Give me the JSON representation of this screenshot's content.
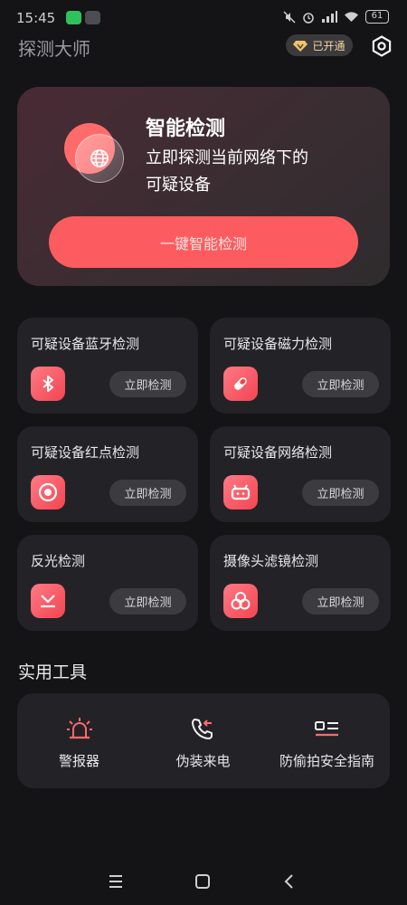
{
  "status": {
    "time": "15:45",
    "battery": "61"
  },
  "app": {
    "title": "探测大师"
  },
  "vip": {
    "label": "已开通"
  },
  "hero": {
    "title": "智能检测",
    "desc_line1": "立即探测当前网络下的",
    "desc_line2": "可疑设备",
    "button": "一键智能检测"
  },
  "cards": [
    {
      "title": "可疑设备蓝牙检测",
      "button": "立即检测",
      "icon": "bluetooth-icon"
    },
    {
      "title": "可疑设备磁力检测",
      "button": "立即检测",
      "icon": "magnet-icon"
    },
    {
      "title": "可疑设备红点检测",
      "button": "立即检测",
      "icon": "red-dot-icon"
    },
    {
      "title": "可疑设备网络检测",
      "button": "立即检测",
      "icon": "router-icon"
    },
    {
      "title": "反光检测",
      "button": "立即检测",
      "icon": "reflection-icon"
    },
    {
      "title": "摄像头滤镜检测",
      "button": "立即检测",
      "icon": "camera-filter-icon"
    }
  ],
  "tools_section": {
    "title": "实用工具"
  },
  "tools": [
    {
      "label": "警报器",
      "icon": "alarm-icon"
    },
    {
      "label": "伪装来电",
      "icon": "fake-call-icon"
    },
    {
      "label": "防偷拍安全指南",
      "icon": "guide-icon"
    }
  ],
  "colors": {
    "accent": "#fc5c5f",
    "background": "#141416",
    "card": "#232327"
  }
}
